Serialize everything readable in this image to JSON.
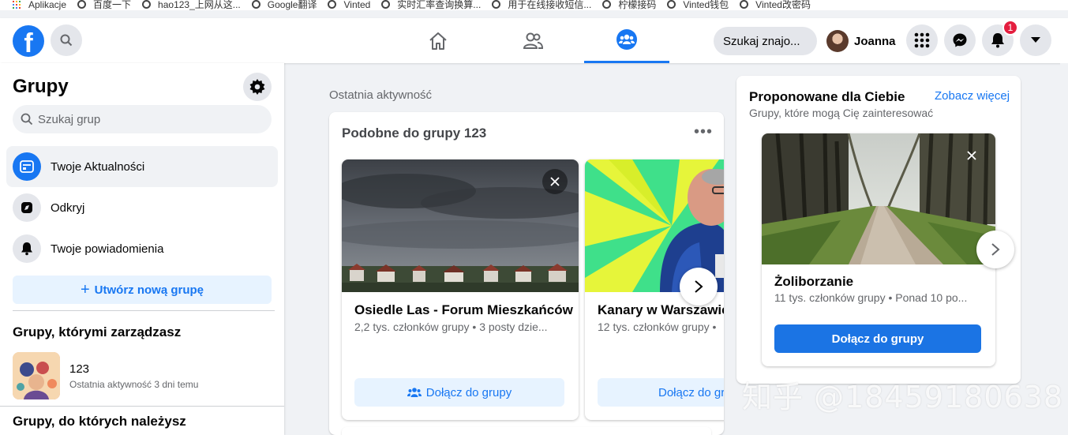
{
  "bookmarks": [
    {
      "label": "Aplikacje",
      "icon": "apps-grid-icon"
    },
    {
      "label": "百度一下",
      "icon": "globe-icon"
    },
    {
      "label": "hao123_上网从这...",
      "icon": "globe-icon"
    },
    {
      "label": "Google翻译",
      "icon": "globe-icon"
    },
    {
      "label": "Vinted",
      "icon": "globe-icon"
    },
    {
      "label": "实时汇率查询换算...",
      "icon": "globe-icon"
    },
    {
      "label": "用于在线接收短信...",
      "icon": "globe-icon"
    },
    {
      "label": "柠檬接码",
      "icon": "globe-icon"
    },
    {
      "label": "Vinted钱包",
      "icon": "globe-icon"
    },
    {
      "label": "Vinted改密码",
      "icon": "globe-icon"
    }
  ],
  "topnav": {
    "logo": "f",
    "search_friends": "Szukaj znajo...",
    "profile_name": "Joanna",
    "notification_count": "1",
    "accent": "#1877f2"
  },
  "sidebar": {
    "title": "Grupy",
    "search_placeholder": "Szukaj grup",
    "items": [
      {
        "label": "Twoje Aktualności"
      },
      {
        "label": "Odkryj"
      },
      {
        "label": "Twoje powiadomienia"
      }
    ],
    "create_label": "Utwórz nową grupę",
    "managed_title": "Grupy, którymi zarządzasz",
    "managed_group": {
      "name": "123",
      "activity": "Ostatnia aktywność 3 dni temu"
    },
    "member_title": "Grupy, do których należysz"
  },
  "main": {
    "recent_label": "Ostatnia aktywność",
    "card_title": "Podobne do grupy 123",
    "groups": [
      {
        "name": "Osiedle Las - Forum Mieszkańców",
        "meta": "2,2 tys. członków grupy • 3 posty dzie...",
        "join": "Dołącz do grupy"
      },
      {
        "name": "Kanary w Warszawie",
        "meta": "12 tys. członków grupy • ",
        "join": "Dołącz do grupy"
      }
    ]
  },
  "suggested": {
    "title": "Proponowane dla Ciebie",
    "see_more": "Zobacz więcej",
    "subtitle": "Grupy, które mogą Cię zainteresować",
    "group": {
      "name": "Żoliborzanie",
      "meta": "11 tys. członków grupy • Ponad 10 po...",
      "join": "Dołącz do grupy"
    }
  },
  "watermark": "知乎 @18459180638"
}
